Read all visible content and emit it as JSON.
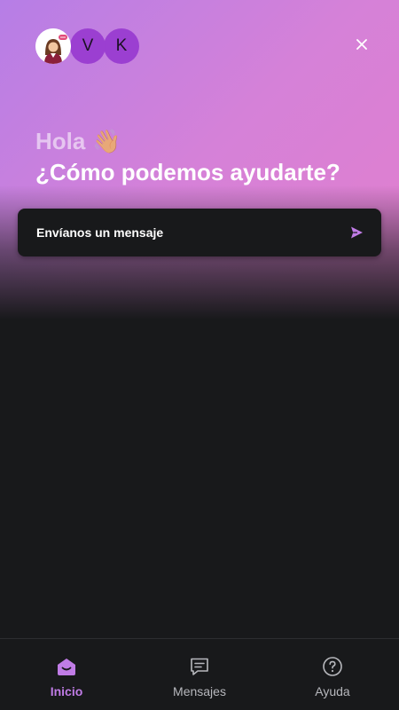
{
  "header": {
    "avatars": [
      {
        "type": "photo",
        "initial": ""
      },
      {
        "type": "initial",
        "initial": "V"
      },
      {
        "type": "initial",
        "initial": "K"
      }
    ],
    "close_icon": "close-icon"
  },
  "greeting": {
    "hello": "Hola",
    "wave_emoji": "👋",
    "question": "¿Cómo podemos ayudarte?"
  },
  "message_card": {
    "label": "Envíanos un mensaje",
    "icon": "send-icon"
  },
  "bottom_nav": {
    "items": [
      {
        "label": "Inicio",
        "icon": "home-icon",
        "active": true
      },
      {
        "label": "Mensajes",
        "icon": "messages-icon",
        "active": false
      },
      {
        "label": "Ayuda",
        "icon": "help-icon",
        "active": false
      }
    ]
  },
  "colors": {
    "accent": "#c07ce6",
    "avatar_purple": "#9b3fd1",
    "gradient_start": "#b67ee6",
    "gradient_end": "#e27fcd",
    "background": "#18191b"
  }
}
